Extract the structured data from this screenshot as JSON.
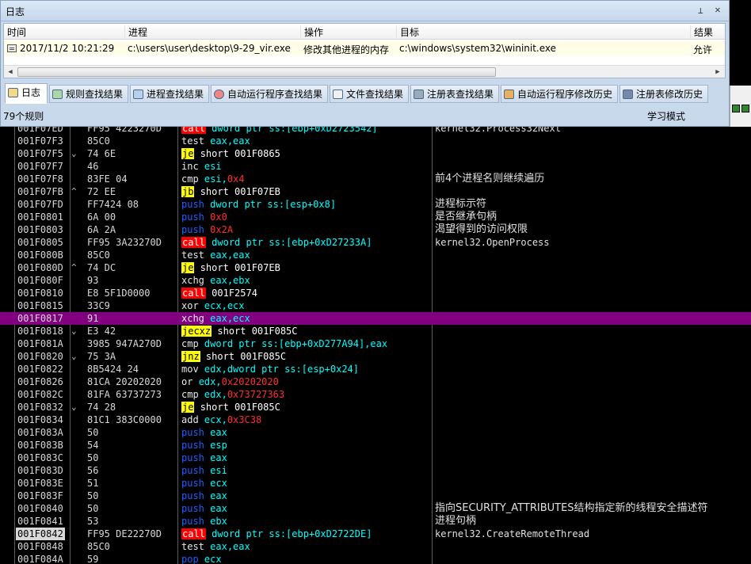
{
  "log_window": {
    "title": "日志",
    "pin_icon": "pin-icon",
    "close_icon": "close-icon",
    "columns": [
      "时间",
      "进程",
      "操作",
      "目标",
      "结果"
    ],
    "row": {
      "time": "2017/11/2 10:21:29",
      "process": "c:\\users\\user\\desktop\\9-29_vir.exe",
      "operation": "修改其他进程的内存",
      "target": "c:\\windows\\system32\\wininit.exe",
      "result": "允许"
    },
    "tabs": [
      {
        "label": "日志",
        "icon": "log-icon"
      },
      {
        "label": "规则查找结果",
        "icon": "rule-icon"
      },
      {
        "label": "进程查找结果",
        "icon": "process-icon"
      },
      {
        "label": "自动运行程序查找结果",
        "icon": "autorun-icon"
      },
      {
        "label": "文件查找结果",
        "icon": "file-icon"
      },
      {
        "label": "注册表查找结果",
        "icon": "registry-icon"
      },
      {
        "label": "自动运行程序修改历史",
        "icon": "autorun-history-icon"
      },
      {
        "label": "注册表修改历史",
        "icon": "registry-history-icon"
      }
    ],
    "status_left": "79个规则",
    "status_right": "学习模式"
  },
  "disasm": {
    "rows": [
      {
        "addr": "001F07ED",
        "arrow": "",
        "hex": "FF95 4223270D",
        "mn": "call",
        "kind": "call",
        "args": "dword ptr ss:[ebp+0xD2723542]",
        "argnum": "",
        "cmt": "kernel32.Process32Next",
        "cmtMono": true
      },
      {
        "addr": "001F07F3",
        "arrow": "",
        "hex": "85C0",
        "mn": "test",
        "kind": "default",
        "args": "eax,eax",
        "argnum": "",
        "cmt": ""
      },
      {
        "addr": "001F07F5",
        "arrow": "⌄",
        "hex": "74 6E",
        "mn": "je",
        "kind": "jump",
        "args": "short 001F0865",
        "argnum": "",
        "cmt": ""
      },
      {
        "addr": "001F07F7",
        "arrow": "",
        "hex": "46",
        "mn": "inc",
        "kind": "default",
        "args": "esi",
        "argnum": "",
        "cmt": ""
      },
      {
        "addr": "001F07F8",
        "arrow": "",
        "hex": "83FE 04",
        "mn": "cmp",
        "kind": "default",
        "args": "esi,",
        "argnum": "0x4",
        "cmt": "前4个进程名则继续遍历"
      },
      {
        "addr": "001F07FB",
        "arrow": "^",
        "hex": "72 EE",
        "mn": "jb",
        "kind": "jump",
        "args": "short 001F07EB",
        "argnum": "",
        "cmt": ""
      },
      {
        "addr": "001F07FD",
        "arrow": "",
        "hex": "FF7424 08",
        "mn": "push",
        "kind": "push",
        "args": "dword ptr ss:[esp+0x8]",
        "argnum": "",
        "cmt": "进程标示符"
      },
      {
        "addr": "001F0801",
        "arrow": "",
        "hex": "6A 00",
        "mn": "push",
        "kind": "push",
        "args": "",
        "argnum": "0x0",
        "cmt": "是否继承句柄"
      },
      {
        "addr": "001F0803",
        "arrow": "",
        "hex": "6A 2A",
        "mn": "push",
        "kind": "push",
        "args": "",
        "argnum": "0x2A",
        "cmt": "渴望得到的访问权限"
      },
      {
        "addr": "001F0805",
        "arrow": "",
        "hex": "FF95 3A23270D",
        "mn": "call",
        "kind": "call",
        "args": "dword ptr ss:[ebp+0xD27233A]",
        "argnum": "",
        "cmt": "kernel32.OpenProcess",
        "cmtMono": true
      },
      {
        "addr": "001F080B",
        "arrow": "",
        "hex": "85C0",
        "mn": "test",
        "kind": "default",
        "args": "eax,eax",
        "argnum": "",
        "cmt": ""
      },
      {
        "addr": "001F080D",
        "arrow": "^",
        "hex": "74 DC",
        "mn": "je",
        "kind": "jump",
        "args": "short 001F07EB",
        "argnum": "",
        "cmt": ""
      },
      {
        "addr": "001F080F",
        "arrow": "",
        "hex": "93",
        "mn": "xchg",
        "kind": "default",
        "args": "eax,ebx",
        "argnum": "",
        "cmt": ""
      },
      {
        "addr": "001F0810",
        "arrow": "",
        "hex": "E8 5F1D0000",
        "mn": "call",
        "kind": "call",
        "args": "001F2574",
        "argnum": "",
        "cmt": ""
      },
      {
        "addr": "001F0815",
        "arrow": "",
        "hex": "33C9",
        "mn": "xor",
        "kind": "default",
        "args": "ecx,ecx",
        "argnum": "",
        "cmt": ""
      },
      {
        "addr": "001F0817",
        "arrow": "",
        "hex": "91",
        "mn": "xchg",
        "kind": "default",
        "args": "eax,ecx",
        "argnum": "",
        "cmt": "",
        "selected": true
      },
      {
        "addr": "001F0818",
        "arrow": "⌄",
        "hex": "E3 42",
        "mn": "jecxz",
        "kind": "jump",
        "args": "short 001F085C",
        "argnum": "",
        "cmt": ""
      },
      {
        "addr": "001F081A",
        "arrow": "",
        "hex": "3985 947A270D",
        "mn": "cmp",
        "kind": "default",
        "args": "dword ptr ss:[ebp+0xD277A94],eax",
        "argnum": "",
        "cmt": ""
      },
      {
        "addr": "001F0820",
        "arrow": "⌄",
        "hex": "75 3A",
        "mn": "jnz",
        "kind": "jump",
        "args": "short 001F085C",
        "argnum": "",
        "cmt": ""
      },
      {
        "addr": "001F0822",
        "arrow": "",
        "hex": "8B5424 24",
        "mn": "mov",
        "kind": "default",
        "args": "edx,dword ptr ss:[esp+0x24]",
        "argnum": "",
        "cmt": ""
      },
      {
        "addr": "001F0826",
        "arrow": "",
        "hex": "81CA 20202020",
        "mn": "or",
        "kind": "default",
        "args": "edx,",
        "argnum": "0x20202020",
        "cmt": ""
      },
      {
        "addr": "001F082C",
        "arrow": "",
        "hex": "81FA 63737273",
        "mn": "cmp",
        "kind": "default",
        "args": "edx,",
        "argnum": "0x73727363",
        "cmt": ""
      },
      {
        "addr": "001F0832",
        "arrow": "⌄",
        "hex": "74 28",
        "mn": "je",
        "kind": "jump",
        "args": "short 001F085C",
        "argnum": "",
        "cmt": ""
      },
      {
        "addr": "001F0834",
        "arrow": "",
        "hex": "81C1 383C0000",
        "mn": "add",
        "kind": "default",
        "args": "ecx,",
        "argnum": "0x3C38",
        "cmt": ""
      },
      {
        "addr": "001F083A",
        "arrow": "",
        "hex": "50",
        "mn": "push",
        "kind": "push",
        "args": "eax",
        "argnum": "",
        "cmt": ""
      },
      {
        "addr": "001F083B",
        "arrow": "",
        "hex": "54",
        "mn": "push",
        "kind": "push",
        "args": "esp",
        "argnum": "",
        "cmt": ""
      },
      {
        "addr": "001F083C",
        "arrow": "",
        "hex": "50",
        "mn": "push",
        "kind": "push",
        "args": "eax",
        "argnum": "",
        "cmt": ""
      },
      {
        "addr": "001F083D",
        "arrow": "",
        "hex": "56",
        "mn": "push",
        "kind": "push",
        "args": "esi",
        "argnum": "",
        "cmt": ""
      },
      {
        "addr": "001F083E",
        "arrow": "",
        "hex": "51",
        "mn": "push",
        "kind": "push",
        "args": "ecx",
        "argnum": "",
        "cmt": ""
      },
      {
        "addr": "001F083F",
        "arrow": "",
        "hex": "50",
        "mn": "push",
        "kind": "push",
        "args": "eax",
        "argnum": "",
        "cmt": ""
      },
      {
        "addr": "001F0840",
        "arrow": "",
        "hex": "50",
        "mn": "push",
        "kind": "push",
        "args": "eax",
        "argnum": "",
        "cmt": "指向SECURITY_ATTRIBUTES结构指定新的线程安全描述符"
      },
      {
        "addr": "001F0841",
        "arrow": "",
        "hex": "53",
        "mn": "push",
        "kind": "push",
        "args": "ebx",
        "argnum": "",
        "cmt": "进程句柄"
      },
      {
        "addr": "001F0842",
        "arrow": "",
        "hex": "FF95 DE22270D",
        "mn": "call",
        "kind": "call",
        "args": "dword ptr ss:[ebp+0xD2722DE]",
        "argnum": "",
        "cmt": "kernel32.CreateRemoteThread",
        "cmtMono": true,
        "addrHighlight": true
      },
      {
        "addr": "001F0848",
        "arrow": "",
        "hex": "85C0",
        "mn": "test",
        "kind": "default",
        "args": "eax,eax",
        "argnum": "",
        "cmt": ""
      },
      {
        "addr": "001F084A",
        "arrow": "",
        "hex": "59",
        "mn": "pop",
        "kind": "blue",
        "args": "ecx",
        "argnum": "",
        "cmt": ""
      }
    ]
  }
}
